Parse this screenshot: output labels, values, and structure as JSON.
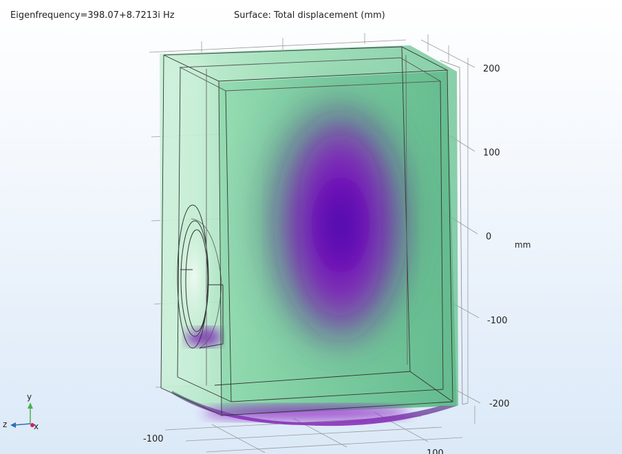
{
  "plot": {
    "eigenfrequency_title": "Eigenfrequency=398.07+8.7213i Hz",
    "surface_title": "Surface: Total displacement (mm)"
  },
  "axes": {
    "y_ticks": [
      "200",
      "100",
      "0",
      "-100",
      "-200"
    ],
    "unit": "mm",
    "x_ticks": [
      "-100",
      "100"
    ]
  },
  "triad": {
    "y": "y",
    "z": "z",
    "x": "x"
  },
  "colors": {
    "background_top": "#ffffff",
    "background_bottom": "#dbe9f8",
    "surface_green": "#7bcf9f",
    "surface_purple": "#7a14b4",
    "surface_core": "#3a0aa8",
    "triad_y": "#4caf50",
    "triad_z": "#2e6fb5",
    "triad_x": "#d81b60"
  }
}
